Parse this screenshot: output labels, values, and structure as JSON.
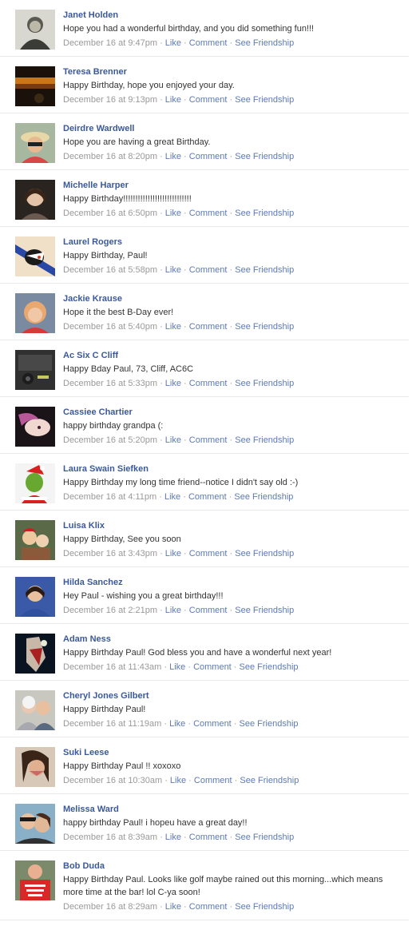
{
  "links": {
    "like": "Like",
    "comment": "Comment",
    "see_friendship": "See Friendship",
    "separator": " · "
  },
  "posts": [
    {
      "name": "Janet Holden",
      "message": "Hope you had a wonderful birthday, and you did something fun!!!",
      "time": "December 16 at 9:47pm"
    },
    {
      "name": "Teresa Brenner",
      "message": "Happy Birthday, hope you enjoyed your day.",
      "time": "December 16 at 9:13pm"
    },
    {
      "name": "Deirdre Wardwell",
      "message": "Hope you are having a great Birthday.",
      "time": "December 16 at 8:20pm"
    },
    {
      "name": "Michelle Harper",
      "message": "Happy Birthday!!!!!!!!!!!!!!!!!!!!!!!!!!!!",
      "time": "December 16 at 6:50pm"
    },
    {
      "name": "Laurel Rogers",
      "message": "Happy Birthday, Paul!",
      "time": "December 16 at 5:58pm"
    },
    {
      "name": "Jackie Krause",
      "message": "Hope it the best B-Day ever!",
      "time": "December 16 at 5:40pm"
    },
    {
      "name": "Ac Six C Cliff",
      "message": "Happy Bday Paul, 73, Cliff, AC6C",
      "time": "December 16 at 5:33pm"
    },
    {
      "name": "Cassiee Chartier",
      "message": "happy birthday grandpa (:",
      "time": "December 16 at 5:20pm"
    },
    {
      "name": "Laura Swain Siefken",
      "message": "Happy Birthday my long time friend--notice I didn't say old :-)",
      "time": "December 16 at 4:11pm"
    },
    {
      "name": "Luisa Klix",
      "message": "Happy Birthday, See you soon",
      "time": "December 16 at 3:43pm"
    },
    {
      "name": "Hilda Sanchez",
      "message": "Hey Paul - wishing you a great birthday!!!",
      "time": "December 16 at 2:21pm"
    },
    {
      "name": "Adam Ness",
      "message": "Happy Birthday Paul! God bless you and have a wonderful next year!",
      "time": "December 16 at 11:43am"
    },
    {
      "name": "Cheryl Jones Gilbert",
      "message": "Happy Birthday Paul!",
      "time": "December 16 at 11:19am"
    },
    {
      "name": "Suki Leese",
      "message": "Happy Birthday Paul !! xoxoxo",
      "time": "December 16 at 10:30am"
    },
    {
      "name": "Melissa Ward",
      "message": "happy birthday Paul! i hopeu have a great day!!",
      "time": "December 16 at 8:39am"
    },
    {
      "name": "Bob Duda",
      "message": "Happy Birthday Paul. Looks like golf maybe rained out this morning...which means more time at the bar! lol C-ya soon!",
      "time": "December 16 at 8:29am"
    }
  ]
}
